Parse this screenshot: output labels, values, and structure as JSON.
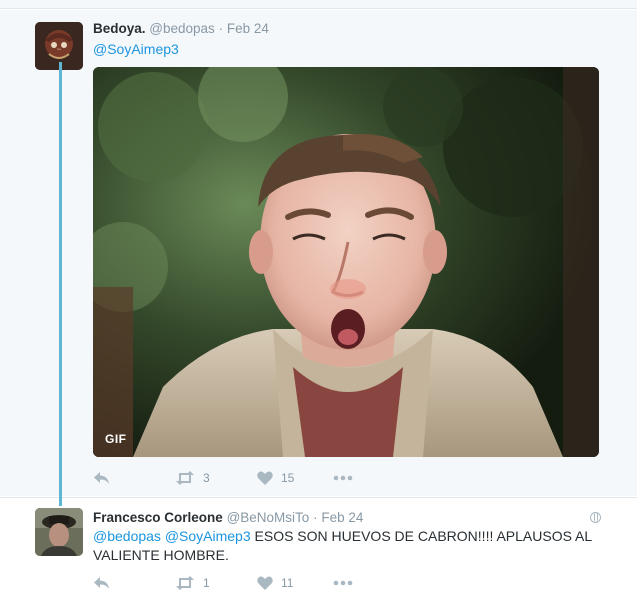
{
  "tweets": [
    {
      "fullname": "Bedoya.",
      "username": "@bedopas",
      "separator": "·",
      "time": "Feb 24",
      "text_mentions": "@SoyAimep3",
      "media_badge": "GIF",
      "media_icon": "gif-animation",
      "actions": {
        "reply_icon": "reply-icon",
        "retweet_count": "3",
        "like_count": "15",
        "more_icon": "more-icon"
      }
    },
    {
      "fullname": "Francesco Corleone",
      "username": "@BeNoMsiTo",
      "separator": "·",
      "time": "Feb 24",
      "text_mentions": "@bedopas @SoyAimep3",
      "text_body": " ESOS SON HUEVOS DE CABRON!!!! APLAUSOS AL VALIENTE HOMBRE.",
      "actions": {
        "reply_icon": "reply-icon",
        "retweet_count": "1",
        "like_count": "11",
        "more_icon": "more-icon"
      }
    }
  ],
  "colors": {
    "accent": "#1b95e0",
    "thread_line": "#5fb7d4",
    "muted": "#8899a6",
    "icon": "#aab8c2",
    "highlight_bg": "#f5f8fa"
  }
}
